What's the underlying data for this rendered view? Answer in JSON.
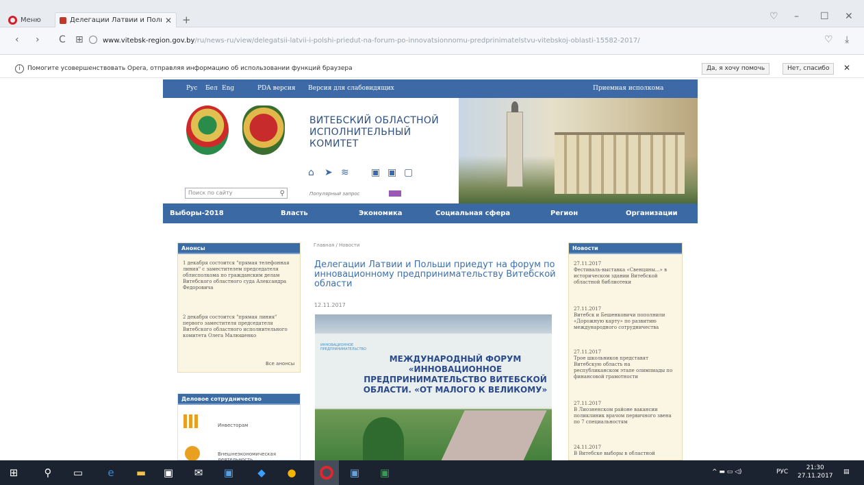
{
  "browser": {
    "menu_label": "Меню",
    "tab_title": "Делегации Латвии и Поль",
    "tab_close": "✕",
    "new_tab": "+",
    "url_host": "www.vitebsk-region.gov.by",
    "url_path": "/ru/news-ru/view/delegatsii-latvii-i-polshi-priedut-na-forum-po-innovatsionnomu-predprinimatelstvu-vitebskoj-oblasti-15582-2017/",
    "infobar_text": "Помогите усовершенствовать Opera, отправляя информацию об использовании функций браузера",
    "infobar_yes": "Да, я хочу помочь",
    "infobar_no": "Нет, спасибо",
    "infobar_close": "✕",
    "nav_back": "‹",
    "nav_forward": "›",
    "nav_reload": "C",
    "nav_speeddial": "⊞",
    "heart": "♡",
    "download": "⤓",
    "win_min": "–",
    "win_max": "☐",
    "win_close": "✕",
    "heart_top": "♡"
  },
  "site": {
    "lang_ru": "Рус",
    "lang_by": "Бел",
    "lang_en": "Eng",
    "pda": "PDA версия",
    "low_vision": "Версия для слабовидящих",
    "reception": "Приемная исполкома",
    "title_line1": "ВИТЕБСКИЙ ОБЛАСТНОЙ",
    "title_line2": "ИСПОЛНИТЕЛЬНЫЙ",
    "title_line3": "КОМИТЕТ",
    "search_placeholder": "Поиск по сайту",
    "search_icon": "⚲",
    "subtext": "Популярный запрос",
    "nav": [
      "Выборы-2018",
      "Власть",
      "Экономика",
      "Социальная сфера",
      "Регион",
      "Организации"
    ],
    "social_icons": [
      "home-icon",
      "telegram-icon",
      "rss-icon",
      "ok-icon",
      "facebook-icon",
      "vk-icon"
    ],
    "social_glyphs": [
      "⌂",
      "➤",
      "≋",
      "▣",
      "▣",
      "▢"
    ]
  },
  "article": {
    "breadcrumb": "Главная / Новости",
    "title": "Делегации Латвии и Польши приедут на форум по инновационному предпринимательству Витебской области",
    "date": "12.11.2017",
    "banner_small": "ИННОВАЦИОННОЕ ПРЕДПРИНИМАТЕЛЬСТВО",
    "banner_text": "МЕЖДУНАРОДНЫЙ ФОРУМ «ИННОВАЦИОННОЕ ПРЕДПРИНИМАТЕЛЬСТВО ВИТЕБСКОЙ ОБЛАСТИ. «ОТ МАЛОГО К ВЕЛИКОМУ»"
  },
  "announcements": {
    "title": "Анонсы",
    "item1": "1 декабря состоится \"прямая телефонная линия\" с заместителем председателя облисполкома по гражданским делам Витебского областного суда Александра Федоровича",
    "item2": "2 декабря состоится \"прямая линия\" первого заместителя председателя Витебского областного исполнительного комитета Олега Малюшенко",
    "all_link": "Все анонсы"
  },
  "business": {
    "title": "Деловое сотрудничество",
    "item1": "Инвесторам",
    "item2": "Внешнеэкономическая деятельность"
  },
  "news": {
    "title": "Новости",
    "items": [
      {
        "date": "27.11.2017",
        "text": "Фестиваль-выставка «Свенцяны...» в историческом здании Витебской областной библиотеки"
      },
      {
        "date": "27.11.2017",
        "text": "Витебск и Бешенковичи пополнили «Дорожную карту» по развитию международного сотрудничества"
      },
      {
        "date": "27.11.2017",
        "text": "Трое школьников представят Витебскую область на республиканском этапе олимпиады по финансовой грамотности"
      },
      {
        "date": "27.11.2017",
        "text": "В Лиозненском районе вакансии поликлиник врачом первичного звена по 7 специальностям"
      },
      {
        "date": "24.11.2017",
        "text": "В Витебске выборы в областной"
      }
    ]
  },
  "taskbar": {
    "lang": "РУС",
    "time": "21:30",
    "date": "27.11.2017",
    "tray_icons": "^ ▬ ▭ ◁)"
  }
}
